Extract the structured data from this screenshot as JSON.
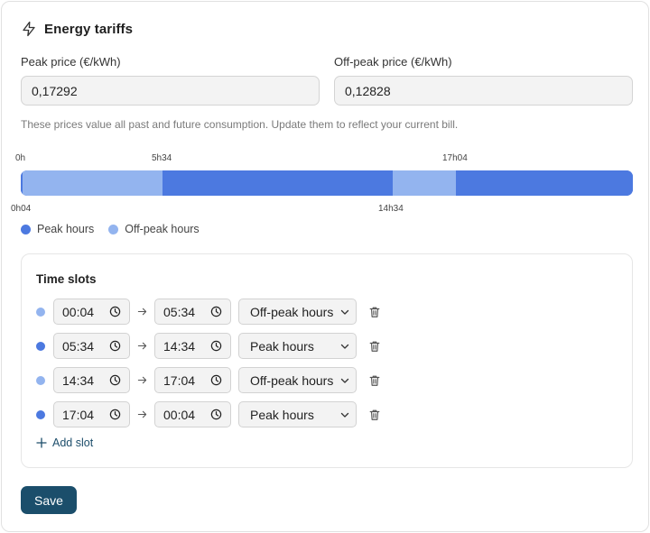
{
  "header": {
    "title": "Energy tariffs",
    "icon": "lightning-icon"
  },
  "fields": {
    "peak": {
      "label": "Peak price (€/kWh)",
      "value": "0,17292"
    },
    "offpeak": {
      "label": "Off-peak price (€/kWh)",
      "value": "0,12828"
    }
  },
  "help_text": "These prices value all past and future consumption. Update them to reflect your current bill.",
  "timeline": {
    "ticks_top": [
      "0h",
      "5h34",
      "17h04"
    ],
    "ticks_bottom": [
      "0h04",
      "14h34"
    ],
    "segments": [
      {
        "type": "peak",
        "start_min": 0,
        "end_min": 4
      },
      {
        "type": "offpeak",
        "start_min": 4,
        "end_min": 334
      },
      {
        "type": "peak",
        "start_min": 334,
        "end_min": 874
      },
      {
        "type": "offpeak",
        "start_min": 874,
        "end_min": 1024
      },
      {
        "type": "peak",
        "start_min": 1024,
        "end_min": 1440
      }
    ]
  },
  "legend": {
    "peak": "Peak hours",
    "offpeak": "Off-peak hours"
  },
  "colors": {
    "peak": "#4c79e0",
    "offpeak": "#93b4ef",
    "primary": "#1b4e6b"
  },
  "slots": {
    "title": "Time slots",
    "rows": [
      {
        "type": "offpeak",
        "start": "00:04",
        "end": "05:34",
        "label": "Off-peak hours"
      },
      {
        "type": "peak",
        "start": "05:34",
        "end": "14:34",
        "label": "Peak hours"
      },
      {
        "type": "offpeak",
        "start": "14:34",
        "end": "17:04",
        "label": "Off-peak hours"
      },
      {
        "type": "peak",
        "start": "17:04",
        "end": "00:04",
        "label": "Peak hours"
      }
    ],
    "add_label": "Add slot"
  },
  "save_label": "Save"
}
